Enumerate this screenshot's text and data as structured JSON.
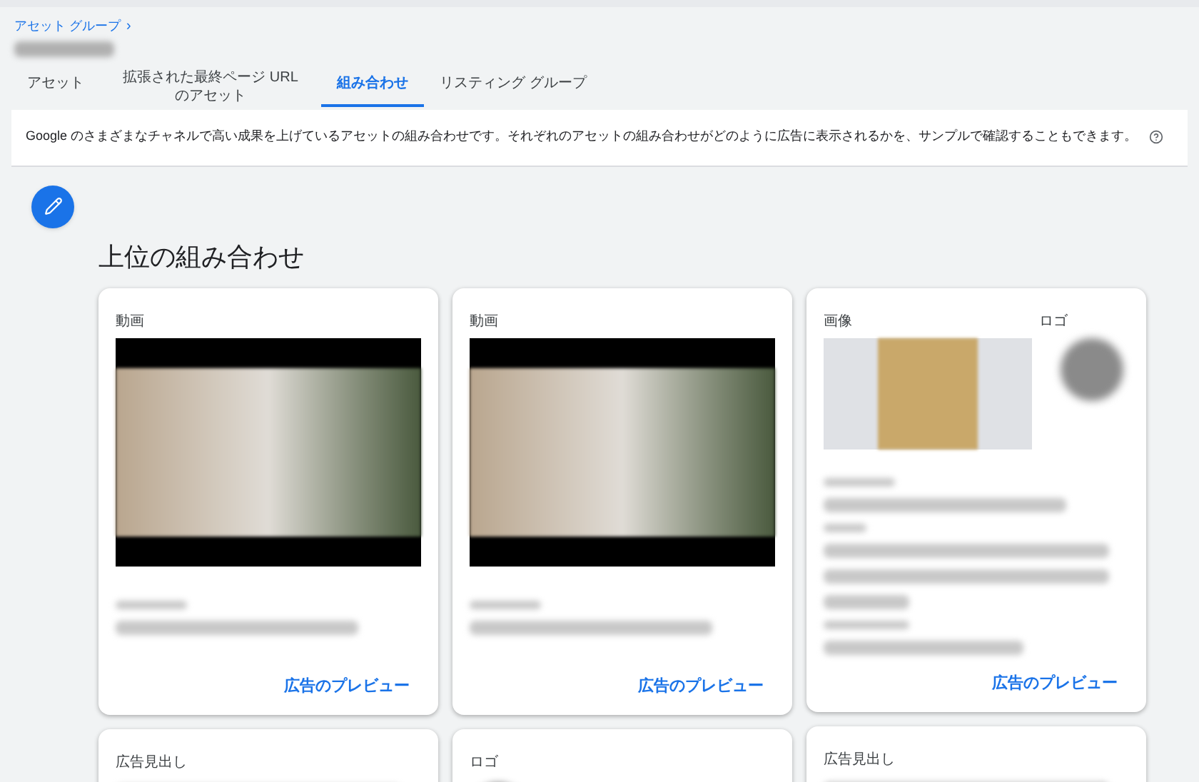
{
  "breadcrumb": {
    "label": "アセット グループ",
    "chevron": "›"
  },
  "tabs": [
    {
      "label": "アセット",
      "selected": false
    },
    {
      "label": "拡張された最終ページ URL のアセット",
      "selected": false
    },
    {
      "label": "組み合わせ",
      "selected": true
    },
    {
      "label": "リスティング グループ",
      "selected": false
    }
  ],
  "info": {
    "text": "Google のさまざまなチャネルで高い成果を上げているアセットの組み合わせです。それぞれのアセットの組み合わせがどのように広告に表示されるかを、サンプルで確認することもできます。"
  },
  "heading": "上位の組み合わせ",
  "columns": [
    {
      "cards": [
        {
          "kind": "video",
          "label": "動画",
          "link": "広告のプレビュー"
        },
        {
          "kind": "headline",
          "label": "広告見出し"
        }
      ]
    },
    {
      "cards": [
        {
          "kind": "video",
          "label": "動画",
          "link": "広告のプレビュー"
        },
        {
          "kind": "logo",
          "label": "ロゴ"
        }
      ]
    },
    {
      "cards": [
        {
          "kind": "image_logo",
          "label": "画像",
          "label_2": "ロゴ",
          "link": "広告のプレビュー"
        },
        {
          "kind": "headline",
          "label": "広告見出し"
        }
      ]
    }
  ]
}
